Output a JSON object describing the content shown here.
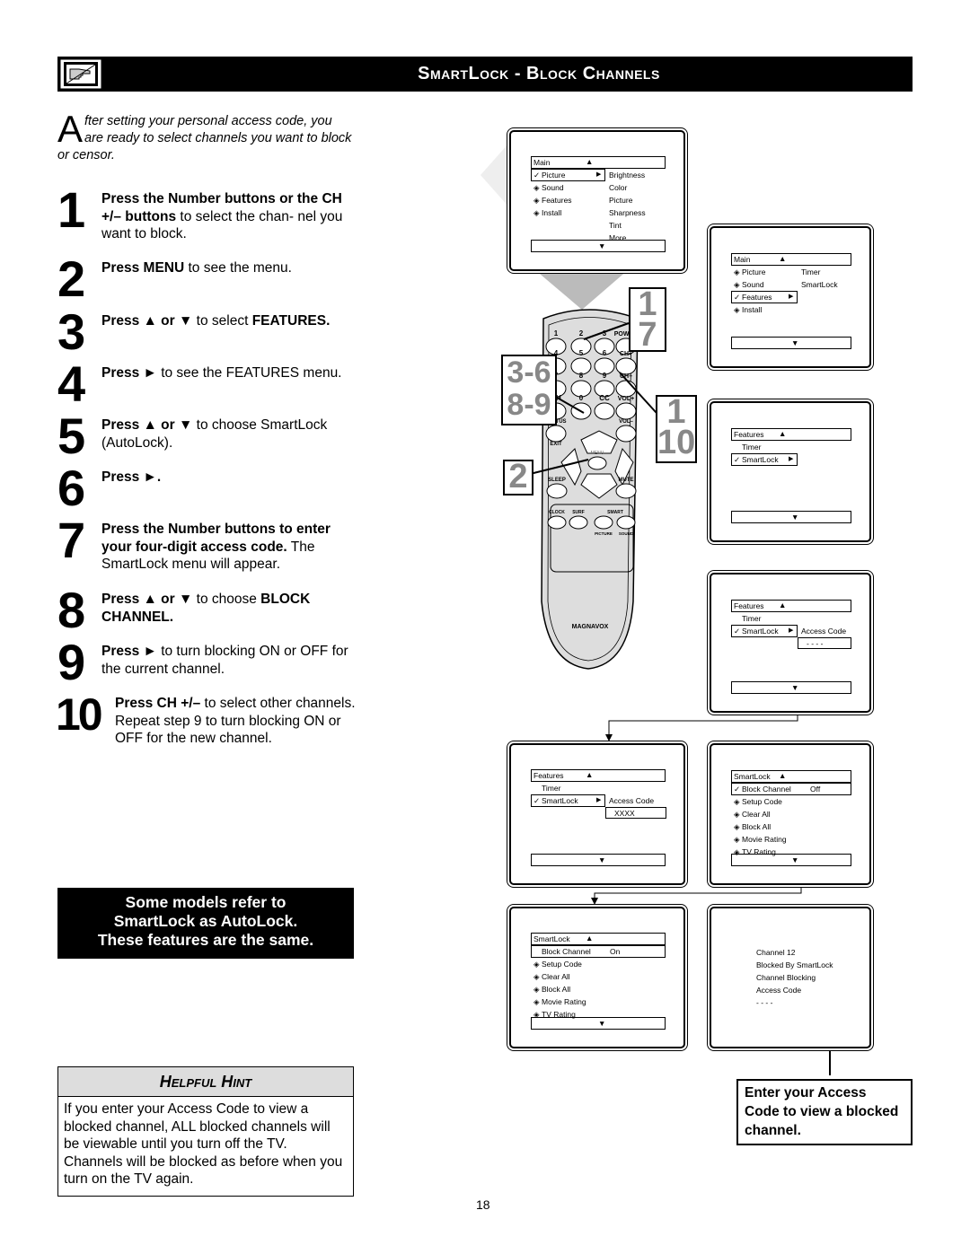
{
  "header": {
    "title": "SmartLock - Block Channels",
    "icon": "pointing-hand-icon"
  },
  "intro": {
    "dropcap": "A",
    "text": "fter setting your personal access code, you are ready to select channels you want to block or censor."
  },
  "steps": [
    {
      "num": "1",
      "parts": [
        {
          "b": true,
          "t": "Press the Number buttons or the CH +/– buttons"
        },
        {
          "b": false,
          "t": " to select the chan- nel you want to block."
        }
      ]
    },
    {
      "num": "2",
      "parts": [
        {
          "b": true,
          "t": "Press MENU"
        },
        {
          "b": false,
          "t": " to see the menu."
        }
      ]
    },
    {
      "num": "3",
      "parts": [
        {
          "b": true,
          "t": "Press ▲ or ▼"
        },
        {
          "b": false,
          "t": " to select "
        },
        {
          "b": true,
          "t": "FEATURES."
        }
      ]
    },
    {
      "num": "4",
      "parts": [
        {
          "b": true,
          "t": "Press ►"
        },
        {
          "b": false,
          "t": " to see the FEATURES menu."
        }
      ]
    },
    {
      "num": "5",
      "parts": [
        {
          "b": true,
          "t": "Press ▲ or ▼"
        },
        {
          "b": false,
          "t": " to choose SmartLock (AutoLock)."
        }
      ]
    },
    {
      "num": "6",
      "parts": [
        {
          "b": true,
          "t": "Press ►."
        }
      ]
    },
    {
      "num": "7",
      "parts": [
        {
          "b": true,
          "t": "Press the Number buttons to enter your four-digit access code."
        },
        {
          "b": false,
          "t": " The SmartLock menu will appear."
        }
      ]
    },
    {
      "num": "8",
      "parts": [
        {
          "b": true,
          "t": "Press ▲ or ▼"
        },
        {
          "b": false,
          "t": " to choose "
        },
        {
          "b": true,
          "t": "BLOCK CHANNEL."
        }
      ]
    },
    {
      "num": "9",
      "parts": [
        {
          "b": true,
          "t": "Press ►"
        },
        {
          "b": false,
          "t": " to turn blocking ON or OFF for the current channel."
        }
      ]
    },
    {
      "num": "10",
      "parts": [
        {
          "b": true,
          "t": "Press CH +/–"
        },
        {
          "b": false,
          "t": " to select other channels. Repeat step 9 to turn blocking ON or OFF for the new channel."
        }
      ]
    }
  ],
  "notice": [
    "Some models refer to",
    "SmartLock as AutoLock.",
    "These features are the same."
  ],
  "hint": {
    "title": "Helpful Hint",
    "text": "If you enter your Access Code to view a blocked channel, ALL blocked channels will be viewable until you turn off the TV. Channels will be blocked as before when you turn on the TV again."
  },
  "enter_note": "Enter your Access Code to view a blocked channel.",
  "page_number": "18",
  "remote": {
    "brand": "MAGNAVOX",
    "keys": [
      "1",
      "2",
      "3",
      "POWER",
      "4",
      "5",
      "6",
      "CH+",
      "7",
      "8",
      "9",
      "CH–",
      "CH",
      "0",
      "CC",
      "VOL+",
      "STATUS",
      "VOL–",
      "EXIT",
      "MENU",
      "SLEEP",
      "MUTE",
      "CLOCK",
      "SURF",
      "SMART",
      "PICTURE",
      "SOUND"
    ],
    "callouts": [
      "1",
      "7",
      "3-6",
      "8-9",
      "1",
      "10",
      "2"
    ]
  },
  "screens": [
    {
      "title": "Main",
      "rows": [
        {
          "mark": "check",
          "label": "Picture",
          "sel": true,
          "arrow": true,
          "value": "Brightness"
        },
        {
          "mark": "diamond",
          "label": "Sound",
          "value": "Color"
        },
        {
          "mark": "diamond",
          "label": "Features",
          "value": "Picture"
        },
        {
          "mark": "diamond",
          "label": "Install",
          "value": "Sharpness"
        },
        {
          "value": "Tint"
        },
        {
          "value": "More..."
        }
      ]
    },
    {
      "title": "Main",
      "rows": [
        {
          "mark": "diamond",
          "label": "Picture",
          "value": "Timer"
        },
        {
          "mark": "diamond",
          "label": "Sound",
          "value": "SmartLock"
        },
        {
          "mark": "check",
          "label": "Features",
          "sel": true,
          "arrow": true
        },
        {
          "mark": "diamond",
          "label": "Install"
        }
      ]
    },
    {
      "title": "Features",
      "rows": [
        {
          "label": "Timer"
        },
        {
          "mark": "check",
          "label": "SmartLock",
          "sel": true,
          "arrow": true
        }
      ]
    },
    {
      "title": "Features",
      "rows": [
        {
          "label": "Timer"
        },
        {
          "mark": "check",
          "label": "SmartLock",
          "sel": true,
          "arrow": true,
          "value": "Access Code"
        },
        {
          "code": "- - - -"
        }
      ]
    },
    {
      "title": "Features",
      "rows": [
        {
          "label": "Timer"
        },
        {
          "mark": "check",
          "label": "SmartLock",
          "sel": true,
          "arrow": true,
          "value": "Access Code"
        },
        {
          "code": "XXXX"
        }
      ]
    },
    {
      "title": "SmartLock",
      "rows": [
        {
          "mark": "check",
          "label": "Block Channel",
          "selwide": true,
          "value": "Off"
        },
        {
          "mark": "diamond",
          "label": "Setup Code"
        },
        {
          "mark": "diamond",
          "label": "Clear All"
        },
        {
          "mark": "diamond",
          "label": "Block All"
        },
        {
          "mark": "diamond",
          "label": "Movie Rating"
        },
        {
          "mark": "diamond",
          "label": "TV Rating"
        }
      ]
    },
    {
      "title": "SmartLock",
      "rows": [
        {
          "label": "Block Channel",
          "selwide": true,
          "value": "On"
        },
        {
          "mark": "diamond",
          "label": "Setup Code"
        },
        {
          "mark": "diamond",
          "label": "Clear All"
        },
        {
          "mark": "diamond",
          "label": "Block All"
        },
        {
          "mark": "diamond",
          "label": "Movie Rating"
        },
        {
          "mark": "diamond",
          "label": "TV Rating"
        }
      ]
    },
    {
      "message": [
        "Channel 12",
        "Blocked By SmartLock",
        "Channel Blocking",
        "Access Code",
        "- - - -"
      ]
    }
  ]
}
